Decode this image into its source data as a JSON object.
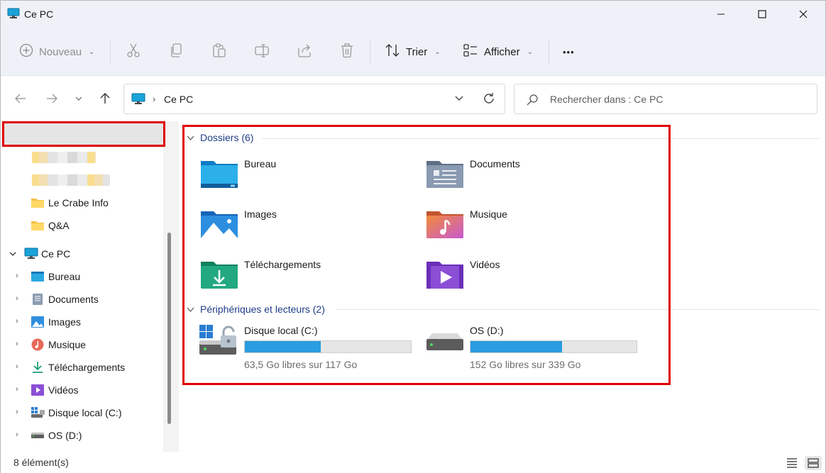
{
  "window": {
    "title": "Ce PC"
  },
  "toolbar": {
    "new_label": "Nouveau",
    "sort_label": "Trier",
    "view_label": "Afficher",
    "more_label": "•••"
  },
  "address": {
    "location": "Ce PC",
    "search_placeholder": "Rechercher dans : Ce PC"
  },
  "sidebar": {
    "quick_access": [
      {
        "label": "Le Crabe Info"
      },
      {
        "label": "Q&A"
      }
    ],
    "this_pc": "Ce PC",
    "items": [
      {
        "label": "Bureau",
        "icon": "desktop-folder-icon"
      },
      {
        "label": "Documents",
        "icon": "documents-folder-icon"
      },
      {
        "label": "Images",
        "icon": "pictures-folder-icon"
      },
      {
        "label": "Musique",
        "icon": "music-folder-icon"
      },
      {
        "label": "Téléchargements",
        "icon": "download-icon"
      },
      {
        "label": "Vidéos",
        "icon": "videos-folder-icon"
      },
      {
        "label": "Disque local (C:)",
        "icon": "system-drive-icon"
      },
      {
        "label": "OS (D:)",
        "icon": "drive-icon"
      }
    ]
  },
  "main": {
    "folders_header": "Dossiers (6)",
    "folders": [
      {
        "label": "Bureau",
        "icon": "desktop-folder-icon"
      },
      {
        "label": "Documents",
        "icon": "documents-folder-icon"
      },
      {
        "label": "Images",
        "icon": "pictures-folder-icon"
      },
      {
        "label": "Musique",
        "icon": "music-folder-icon"
      },
      {
        "label": "Téléchargements",
        "icon": "downloads-folder-icon"
      },
      {
        "label": "Vidéos",
        "icon": "videos-folder-icon"
      }
    ],
    "devices_header": "Périphériques et lecteurs (2)",
    "drives": [
      {
        "label": "Disque local (C:)",
        "free_text": "63,5 Go libres sur 117 Go",
        "used_fraction": 0.457
      },
      {
        "label": "OS (D:)",
        "free_text": "152 Go libres sur 339 Go",
        "used_fraction": 0.552
      }
    ]
  },
  "status": {
    "count": "8 élément(s)"
  },
  "colors": {
    "accent": "#2a9de0",
    "highlight_border": "#e00000",
    "group_header": "#1f3c88"
  }
}
